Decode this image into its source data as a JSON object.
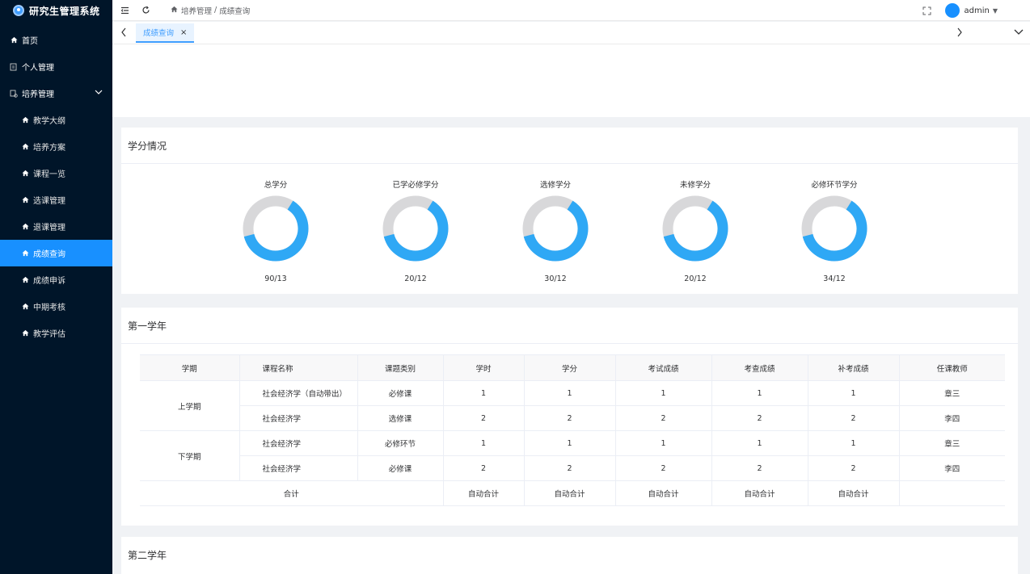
{
  "app": {
    "title": "研究生管理系统"
  },
  "sidebar": {
    "items": [
      {
        "label": "首页",
        "icon": "home-icon"
      },
      {
        "label": "个人管理",
        "icon": "user-doc-icon"
      },
      {
        "label": "培养管理",
        "icon": "training-icon"
      }
    ],
    "sub_items": [
      {
        "label": "教学大纲"
      },
      {
        "label": "培养方案"
      },
      {
        "label": "课程一览"
      },
      {
        "label": "选课管理"
      },
      {
        "label": "退课管理"
      },
      {
        "label": "成绩查询"
      },
      {
        "label": "成绩申诉"
      },
      {
        "label": "中期考核"
      },
      {
        "label": "教学评估"
      }
    ],
    "active_item": "成绩查询"
  },
  "header": {
    "breadcrumb": [
      "培养管理",
      "成绩查询"
    ],
    "breadcrumb_sep": "/",
    "username": "admin"
  },
  "tabs": [
    {
      "label": "成绩查询",
      "close": "×"
    }
  ],
  "credit_card": {
    "title": "学分情况",
    "donuts": [
      {
        "label": "总学分",
        "value": "90/13",
        "ratio": 0.62
      },
      {
        "label": "已学必修学分",
        "value": "20/12",
        "ratio": 0.62
      },
      {
        "label": "选修学分",
        "value": "30/12",
        "ratio": 0.62
      },
      {
        "label": "未修学分",
        "value": "20/12",
        "ratio": 0.62
      },
      {
        "label": "必修环节学分",
        "value": "34/12",
        "ratio": 0.62
      }
    ],
    "colors": {
      "filled": "#2fa8f5",
      "track": "#d8d8da"
    }
  },
  "year1": {
    "title": "第一学年",
    "headers": [
      "学期",
      "课程名称",
      "课题类别",
      "学时",
      "学分",
      "考试成绩",
      "考查成绩",
      "补考成绩",
      "任课教师"
    ],
    "terms": [
      {
        "term": "上学期",
        "rows": [
          [
            "社会经济学（自动带出）",
            "必修课",
            "1",
            "1",
            "1",
            "1",
            "1",
            "章三"
          ],
          [
            "社会经济学",
            "选修课",
            "2",
            "2",
            "2",
            "2",
            "2",
            "李四"
          ]
        ]
      },
      {
        "term": "下学期",
        "rows": [
          [
            "社会经济学",
            "必修环节",
            "1",
            "1",
            "1",
            "1",
            "1",
            "章三"
          ],
          [
            "社会经济学",
            "必修课",
            "2",
            "2",
            "2",
            "2",
            "2",
            "李四"
          ]
        ]
      }
    ],
    "total_label": "合计",
    "total_values": [
      "自动合计",
      "自动合计",
      "自动合计",
      "自动合计",
      "自动合计",
      ""
    ]
  },
  "year2": {
    "title": "第二学年"
  }
}
